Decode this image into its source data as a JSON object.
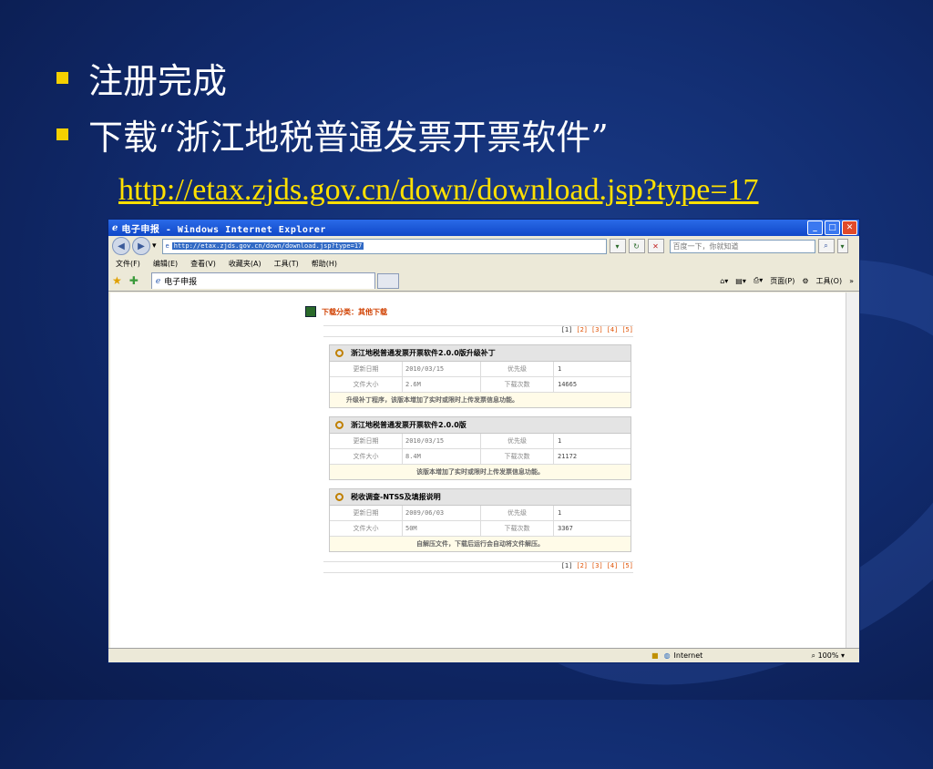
{
  "slide": {
    "bullet1": "注册完成",
    "bullet2": "下载“浙江地税普通发票开票软件”",
    "url": "http://etax.zjds.gov.cn/down/download.jsp?type=17"
  },
  "browser": {
    "title": "电子申报 - Windows Internet Explorer",
    "address": "http://etax.zjds.gov.cn/down/download.jsp?type=17",
    "search_placeholder": "百度一下，你就知道",
    "menus": [
      "文件(F)",
      "编辑(E)",
      "查看(V)",
      "收藏夹(A)",
      "工具(T)",
      "帮助(H)"
    ],
    "tab_label": "电子申报",
    "tools": [
      "页面(P)",
      "工具(O)"
    ],
    "status_zone": "Internet",
    "zoom": "100%"
  },
  "page": {
    "category": "下载分类：其他下载",
    "pager": {
      "current": "[1]",
      "links": [
        "[2]",
        "[3]",
        "[4]",
        "[5]"
      ]
    },
    "cards": [
      {
        "title": "浙江地税普通发票开票软件2.0.0版升级补丁",
        "date_label": "更新日期",
        "date": "2010/03/15",
        "prio_label": "优先级",
        "prio": "1",
        "size_label": "文件大小",
        "size": "2.6M",
        "dl_label": "下载次数",
        "dl": "14665",
        "desc": "升级补丁程序，该版本增加了实时或限时上传发票信息功能。"
      },
      {
        "title": "浙江地税普通发票开票软件2.0.0版",
        "date_label": "更新日期",
        "date": "2010/03/15",
        "prio_label": "优先级",
        "prio": "1",
        "size_label": "文件大小",
        "size": "8.4M",
        "dl_label": "下载次数",
        "dl": "21172",
        "desc": "该版本增加了实时或限时上传发票信息功能。"
      },
      {
        "title": "税收调查-NTSS及填报说明",
        "date_label": "更新日期",
        "date": "2009/06/03",
        "prio_label": "优先级",
        "prio": "1",
        "size_label": "文件大小",
        "size": "50M",
        "dl_label": "下载次数",
        "dl": "3367",
        "desc": "自解压文件，下载后运行会自动将文件解压。"
      }
    ]
  },
  "colors": {
    "accent_yellow": "#f5d000",
    "slide_bg": "#10296a",
    "link_orange": "#e05000"
  }
}
